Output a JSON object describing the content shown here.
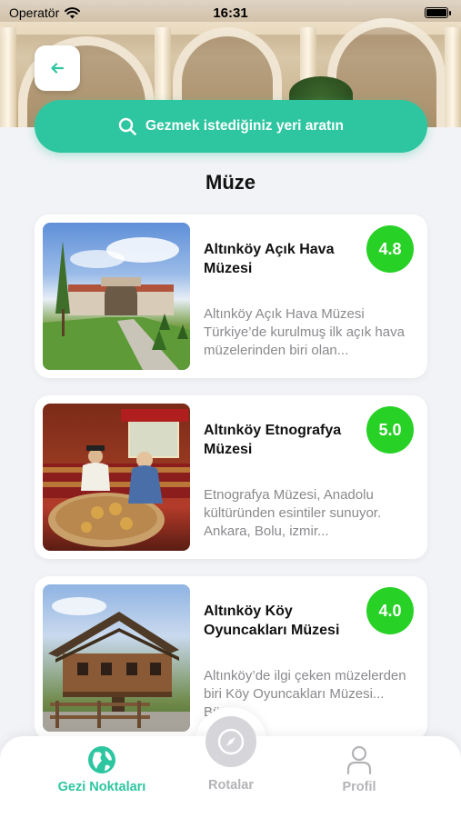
{
  "status_bar": {
    "carrier": "Operatör",
    "time": "16:31"
  },
  "search": {
    "placeholder": "Gezmek istediğiniz yeri aratın"
  },
  "section": {
    "title": "Müze"
  },
  "places": [
    {
      "name": "Altınköy Açık Hava Müzesi",
      "rating": "4.8",
      "description": "Altınköy Açık Hava Müzesi Türkiye’de kurulmuş ilk açık hava müzelerinden biri olan..."
    },
    {
      "name": "Altınköy Etnografya Müzesi",
      "rating": "5.0",
      "description": "Etnografya Müzesi, Anadolu kültüründen esintiler sunuyor. Ankara, Bolu, izmir..."
    },
    {
      "name": "Altınköy Köy Oyuncakları Müzesi",
      "rating": "4.0",
      "description": "Altınköy’de ilgi çeken müzelerden biri Köy Oyuncakları Müzesi... Büyü..."
    }
  ],
  "tabs": [
    {
      "label": "Gezi Noktaları",
      "icon": "globe-icon",
      "active": true
    },
    {
      "label": "Rotalar",
      "icon": "compass-icon",
      "active": false
    },
    {
      "label": "Profil",
      "icon": "user-icon",
      "active": false
    }
  ],
  "colors": {
    "accent": "#2dc6a0",
    "rating": "#27d126",
    "muted": "#8a8a8e"
  }
}
